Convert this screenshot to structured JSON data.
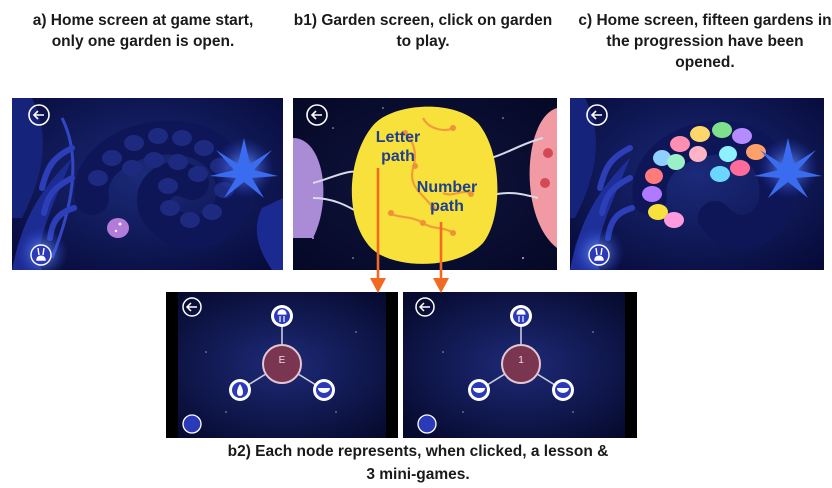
{
  "captions": {
    "a": "a) Home screen at game start, only one garden is open.",
    "b1": "b1) Garden screen, click on garden to play.",
    "c": "c) Home screen,  fifteen gardens in the progression have been opened.",
    "b2_line1": "b2) Each node represents, when clicked, a lesson &",
    "b2_line2": "3 mini-games."
  },
  "annotations": {
    "letter_path": "Letter path",
    "number_path": "Number path"
  },
  "nodes": {
    "letter_center": "E",
    "number_center": "1"
  },
  "icons": {
    "back": "back-arrow-icon",
    "menu": "bunny-icon"
  },
  "colors": {
    "arrow": "#f26a21",
    "label": "#1f3f8f",
    "garden": "#f7e13a",
    "node_center": "#7a3550"
  }
}
